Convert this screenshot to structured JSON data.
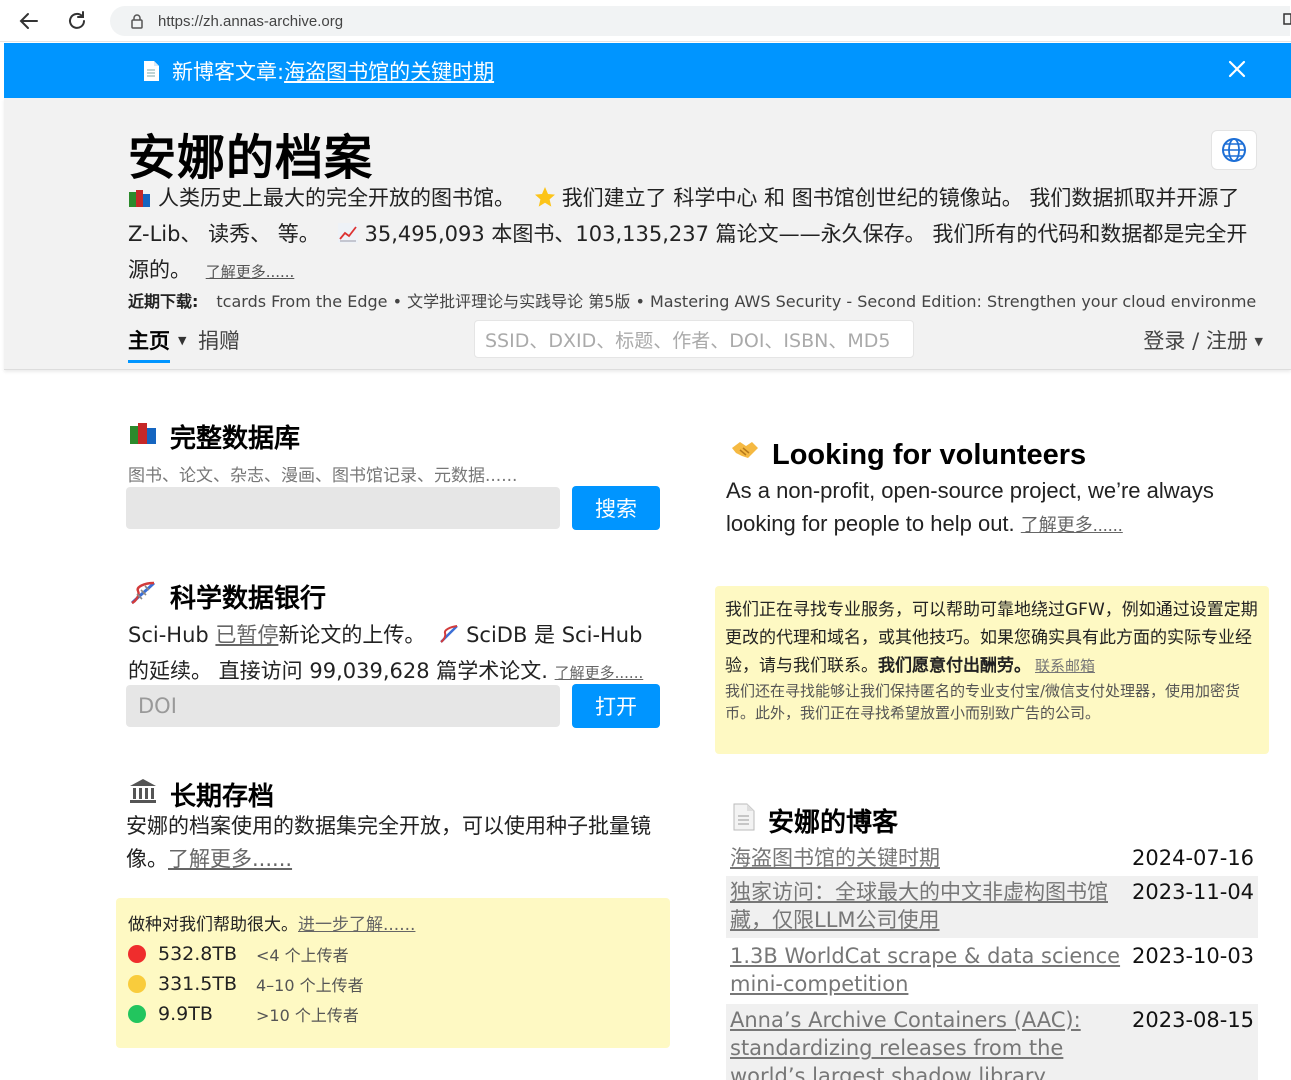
{
  "browser": {
    "url": "https://zh.annas-archive.org"
  },
  "banner": {
    "prefix": "新博客文章: ",
    "link": "海盗图书馆的关键时期"
  },
  "header": {
    "title": "安娜的档案",
    "intro_1": "人类历史上最大的完全开放的图书馆。",
    "intro_2": "我们建立了 科学中心 和 图书馆创世纪的镜像站。 我们数据抓取并开源了Z-Lib、 读秀、 等。",
    "intro_3": "35,495,093 本图书、103,135,237 篇论文——永久保存。 我们所有的代码和数据都是完全开源的。",
    "intro_more": "了解更多......",
    "recent_label": "近期下载:",
    "recent_items": "tcards From the Edge • 文学批评理论与实践导论 第5版 • Mastering AWS Security - Second Edition: Strengthen your cloud environmer"
  },
  "nav": {
    "home": "主页",
    "donate": "捐赠",
    "search_placeholder": "SSID、DXID、标题、作者、DOI、ISBN、MD5",
    "login": "登录 / 注册"
  },
  "full_db": {
    "title": "完整数据库",
    "subtitle": "图书、论文、杂志、漫画、图书馆记录、元数据......",
    "button": "搜索"
  },
  "scidb": {
    "title": "科学数据银行",
    "text_1": "Sci-Hub ",
    "link_paused": "已暂停",
    "text_2": "新论文的上传。",
    "text_3": "SciDB 是 Sci-Hub 的延续。 直接访问 99,039,628 篇学术论文.",
    "more": "了解更多......",
    "input_placeholder": "DOI",
    "button": "打开"
  },
  "archive": {
    "title": "长期存档",
    "text": "安娜的档案使用的数据集完全开放，可以使用种子批量镜像。",
    "more": "了解更多......"
  },
  "seeding": {
    "text": "做种对我们帮助很大。",
    "more": "进一步了解......",
    "rows": [
      {
        "size": "532.8TB",
        "label": "<4 个上传者",
        "color": "#ef2d2d"
      },
      {
        "size": "331.5TB",
        "label": "4–10 个上传者",
        "color": "#f9cc3c"
      },
      {
        "size": "9.9TB",
        "label": ">10 个上传者",
        "color": "#22c55e"
      }
    ]
  },
  "volunteers": {
    "title": "Looking for volunteers",
    "text": "As a non-profit, open-source project, we’re always looking for people to help out.",
    "more": "了解更多......"
  },
  "gfw": {
    "text": "我们正在寻找专业服务，可以帮助可靠地绕过GFW，例如通过设置定期更改的代理和域名，或其他技巧。如果您确实具有此方面的实际专业经验，请与我们联系。",
    "bold": "我们愿意付出酬劳。",
    "link": "联系邮箱",
    "text_2": "我们还在寻找能够让我们保持匿名的专业支付宝/微信支付处理器，使用加密货币。此外，我们正在寻找希望放置小而别致广告的公司。"
  },
  "blog": {
    "title": "安娜的博客",
    "posts": [
      {
        "title": "海盗图书馆的关键时期",
        "date": "2024-07-16"
      },
      {
        "title": "独家访问：全球最大的中文非虚构图书馆藏，仅限LLM公司使用",
        "date": "2023-11-04"
      },
      {
        "title": "1.3B WorldCat scrape & data science mini-competition",
        "date": "2023-10-03"
      },
      {
        "title": "Anna’s Archive Containers (AAC): standardizing releases from the world’s largest shadow library",
        "date": "2023-08-15"
      }
    ]
  },
  "colors": {
    "accent": "#0095ff",
    "header_bg": "#f2f2f2",
    "note_bg": "#fef9c3"
  }
}
